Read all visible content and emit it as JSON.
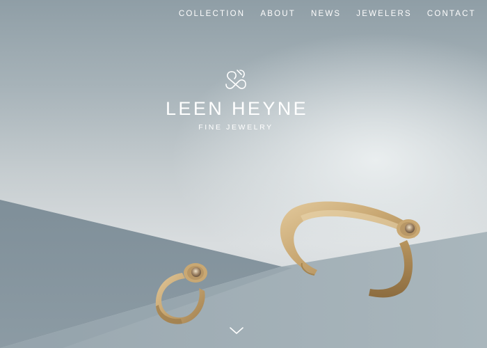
{
  "nav": {
    "items": [
      {
        "label": "COLLECTION"
      },
      {
        "label": "ABOUT"
      },
      {
        "label": "NEWS"
      },
      {
        "label": "JEWELERS"
      },
      {
        "label": "CONTACT"
      }
    ]
  },
  "brand": {
    "name": "LEEN HEYNE",
    "tagline": "FINE JEWELRY",
    "logo_icon": "infinity-knot-icon"
  },
  "hero": {
    "scroll_icon": "chevron-down-icon",
    "colors": {
      "gold": "#c8a878",
      "slate": "#8797a1",
      "backdrop": "#d9dddf"
    }
  }
}
